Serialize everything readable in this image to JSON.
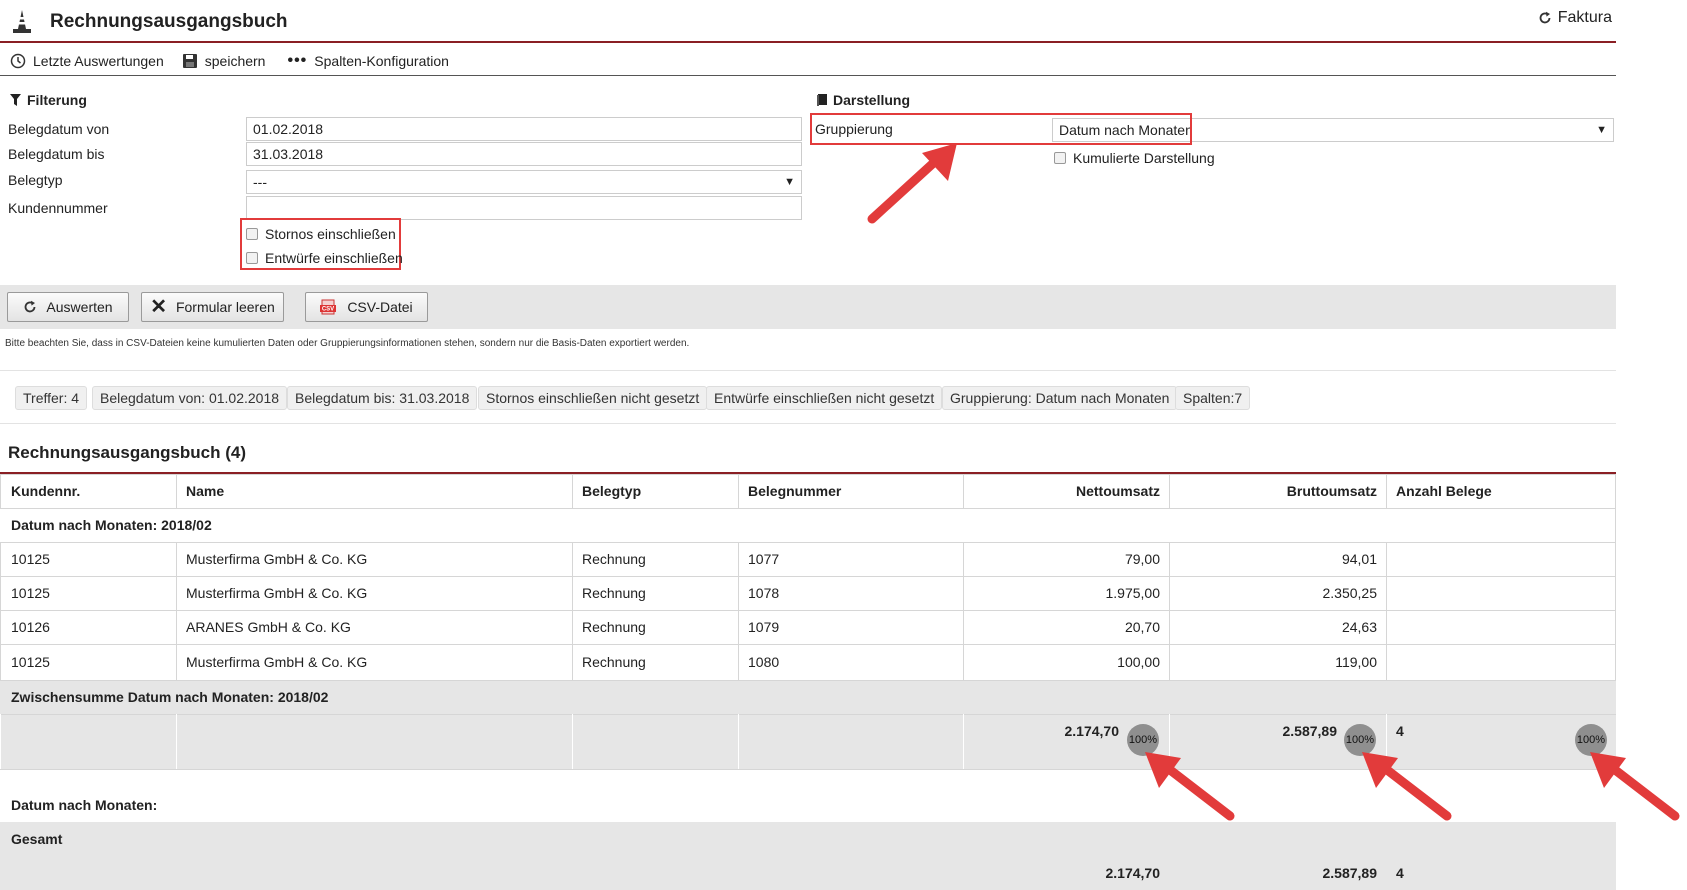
{
  "header": {
    "title": "Rechnungsausgangsbuch",
    "right_link": "Faktura"
  },
  "toolbar": {
    "recent": "Letzte Auswertungen",
    "save": "speichern",
    "columns": "Spalten-Konfiguration"
  },
  "filter": {
    "heading": "Filterung",
    "date_from_label": "Belegdatum von",
    "date_from_value": "01.02.2018",
    "date_to_label": "Belegdatum bis",
    "date_to_value": "31.03.2018",
    "type_label": "Belegtyp",
    "type_value": "---",
    "customer_label": "Kundennummer",
    "customer_value": "",
    "storno_label": "Stornos einschließen",
    "draft_label": "Entwürfe einschließen"
  },
  "display": {
    "heading": "Darstellung",
    "grouping_label": "Gruppierung",
    "grouping_value": "Datum nach Monaten",
    "cumulative_label": "Kumulierte Darstellung"
  },
  "buttons": {
    "evaluate": "Auswerten",
    "clear": "Formular leeren",
    "csv": "CSV-Datei"
  },
  "hint": "Bitte beachten Sie, dass in CSV-Dateien keine kumulierten Daten oder Gruppierungsinformationen stehen, sondern nur die Basis-Daten exportiert werden.",
  "chips": [
    "Treffer: 4",
    "Belegdatum von: 01.02.2018",
    "Belegdatum bis: 31.03.2018",
    "Stornos einschließen nicht gesetzt",
    "Entwürfe einschließen nicht gesetzt",
    "Gruppierung: Datum nach Monaten",
    "Spalten:7"
  ],
  "table": {
    "title": "Rechnungsausgangsbuch (4)",
    "columns": [
      "Kundennr.",
      "Name",
      "Belegtyp",
      "Belegnummer",
      "Nettoumsatz",
      "Bruttoumsatz",
      "Anzahl Belege"
    ],
    "group_header": "Datum nach Monaten: 2018/02",
    "rows": [
      [
        "10125",
        "Musterfirma GmbH & Co. KG",
        "Rechnung",
        "1077",
        "79,00",
        "94,01"
      ],
      [
        "10125",
        "Musterfirma GmbH & Co. KG",
        "Rechnung",
        "1078",
        "1.975,00",
        "2.350,25"
      ],
      [
        "10126",
        "ARANES GmbH & Co. KG",
        "Rechnung",
        "1079",
        "20,70",
        "24,63"
      ],
      [
        "10125",
        "Musterfirma GmbH & Co. KG",
        "Rechnung",
        "1080",
        "100,00",
        "119,00"
      ]
    ],
    "subtotal_label": "Zwischensumme Datum nach Monaten: 2018/02",
    "subtotal": {
      "net": "2.174,70",
      "gross": "2.587,89",
      "count": "4",
      "pct": "100%"
    },
    "group_footer": "Datum nach Monaten:",
    "total_label": "Gesamt",
    "total": {
      "net": "2.174,70",
      "gross": "2.587,89",
      "count": "4"
    }
  },
  "colors": {
    "accent": "#8a1f24",
    "highlight": "#e23b3b",
    "shaded": "#e6e6e6"
  }
}
